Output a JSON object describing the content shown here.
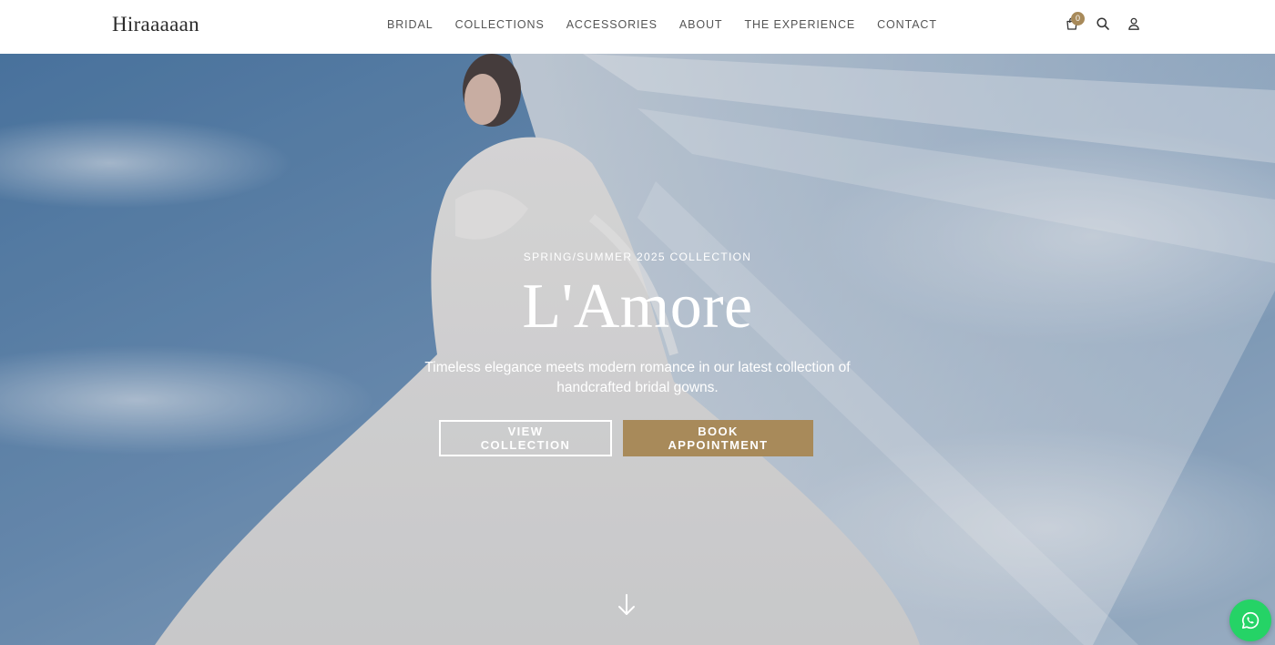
{
  "brand": {
    "logo": "Hiraaaaan"
  },
  "nav": {
    "items": [
      {
        "label": "BRIDAL"
      },
      {
        "label": "COLLECTIONS"
      },
      {
        "label": "ACCESSORIES"
      },
      {
        "label": "ABOUT"
      },
      {
        "label": "THE EXPERIENCE"
      },
      {
        "label": "CONTACT"
      }
    ]
  },
  "utils": {
    "cart_count": "0",
    "icons": [
      "shopping-bag-icon",
      "search-icon",
      "user-icon"
    ]
  },
  "hero": {
    "eyebrow": "SPRING/SUMMER 2025 COLLECTION",
    "title": "L'Amore",
    "subtitle": "Timeless elegance meets modern romance in our latest collection of handcrafted bridal gowns.",
    "primary_cta": "VIEW COLLECTION",
    "secondary_cta": "BOOK APPOINTMENT",
    "scroll_icon": "arrow-down-icon"
  },
  "floating": {
    "icon": "whatsapp-icon"
  },
  "colors": {
    "accent": "#a88a5a",
    "whatsapp": "#25d366",
    "nav_text": "#555555"
  }
}
